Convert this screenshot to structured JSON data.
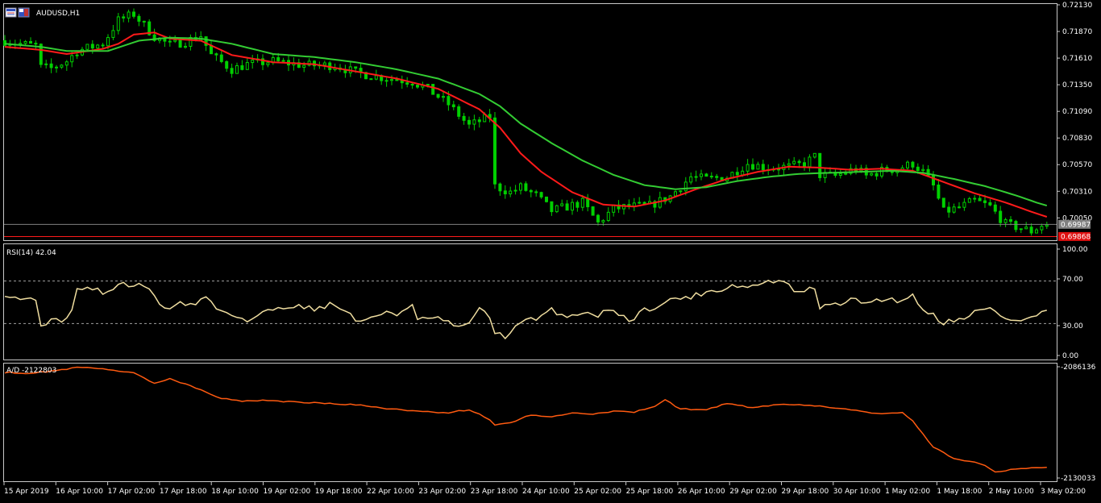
{
  "window": {
    "title": "AUDUSD,H1"
  },
  "colors": {
    "background": "#000000",
    "frame": "#c8c8c8",
    "text": "#ffffff",
    "candle": "#00d000",
    "ma_fast": "#ff1a1a",
    "ma_slow": "#33cc33",
    "bid_line": "#808080",
    "ask_line": "#ff1a1a",
    "bid_tag": "#808080",
    "ask_tag": "#e01010",
    "rsi": "#f0dea0",
    "rsi_levels": "#a0a0a0",
    "ad": "#ff5a10"
  },
  "icons": [
    "chart-window-icon"
  ],
  "main_pane": {
    "symbol_label": "AUDUSD,H1",
    "price_axis": [
      "0.72130",
      "0.71870",
      "0.71610",
      "0.71350",
      "0.71090",
      "0.70830",
      "0.70570",
      "0.70310",
      "0.70050"
    ],
    "bid_tag": "0.69987",
    "ask_tag": "0.69868"
  },
  "rsi_pane": {
    "label": "RSI(14) 42.04",
    "axis": [
      "100.00",
      "70.00",
      "30.00",
      "0.00"
    ]
  },
  "ad_pane": {
    "label": "A/D -2122803",
    "axis_top": "-2086136",
    "axis_bottom": "-2130033"
  },
  "time_axis": [
    "15 Apr 2019",
    "16 Apr 10:00",
    "17 Apr 02:00",
    "17 Apr 18:00",
    "18 Apr 10:00",
    "19 Apr 02:00",
    "19 Apr 18:00",
    "22 Apr 10:00",
    "23 Apr 02:00",
    "23 Apr 18:00",
    "24 Apr 10:00",
    "25 Apr 02:00",
    "25 Apr 18:00",
    "26 Apr 10:00",
    "29 Apr 02:00",
    "29 Apr 18:00",
    "30 Apr 10:00",
    "1 May 02:00",
    "1 May 18:00",
    "2 May 10:00",
    "3 May 02:00"
  ],
  "chart_data": [
    {
      "type": "candlestick",
      "title": "AUDUSD,H1",
      "ylim": [
        0.6984,
        0.7213
      ],
      "x_tick_labels": [
        "15 Apr 2019",
        "16 Apr 10:00",
        "17 Apr 02:00",
        "17 Apr 18:00",
        "18 Apr 10:00",
        "19 Apr 02:00",
        "19 Apr 18:00",
        "22 Apr 10:00",
        "23 Apr 02:00",
        "23 Apr 18:00",
        "24 Apr 10:00",
        "25 Apr 02:00",
        "25 Apr 18:00",
        "26 Apr 10:00",
        "29 Apr 02:00",
        "29 Apr 18:00",
        "30 Apr 10:00",
        "1 May 02:00",
        "1 May 18:00",
        "2 May 10:00",
        "3 May 02:00"
      ],
      "close_path": [
        [
          0,
          0.7178
        ],
        [
          3,
          0.7175
        ],
        [
          6,
          0.7173
        ],
        [
          7,
          0.7152
        ],
        [
          9,
          0.7151
        ],
        [
          12,
          0.7158
        ],
        [
          14,
          0.7168
        ],
        [
          19,
          0.7175
        ],
        [
          22,
          0.7198
        ],
        [
          25,
          0.7204
        ],
        [
          29,
          0.7182
        ],
        [
          32,
          0.7174
        ],
        [
          35,
          0.7177
        ],
        [
          38,
          0.7183
        ],
        [
          40,
          0.7164
        ],
        [
          44,
          0.715
        ],
        [
          47,
          0.7155
        ],
        [
          52,
          0.7158
        ],
        [
          58,
          0.7154
        ],
        [
          64,
          0.7154
        ],
        [
          68,
          0.7147
        ],
        [
          72,
          0.7143
        ],
        [
          76,
          0.714
        ],
        [
          79,
          0.7138
        ],
        [
          82,
          0.7131
        ],
        [
          86,
          0.7116
        ],
        [
          90,
          0.7095
        ],
        [
          94,
          0.7104
        ],
        [
          95,
          0.7036
        ],
        [
          98,
          0.703
        ],
        [
          100,
          0.7035
        ],
        [
          103,
          0.7027
        ],
        [
          106,
          0.7012
        ],
        [
          109,
          0.7016
        ],
        [
          112,
          0.702
        ],
        [
          115,
          0.7
        ],
        [
          118,
          0.7014
        ],
        [
          121,
          0.7016
        ],
        [
          125,
          0.7017
        ],
        [
          129,
          0.7026
        ],
        [
          133,
          0.7045
        ],
        [
          136,
          0.7043
        ],
        [
          140,
          0.7045
        ],
        [
          144,
          0.7058
        ],
        [
          148,
          0.7054
        ],
        [
          152,
          0.7055
        ],
        [
          155,
          0.7058
        ],
        [
          157,
          0.7065
        ],
        [
          158,
          0.7047
        ],
        [
          161,
          0.7046
        ],
        [
          165,
          0.7053
        ],
        [
          167,
          0.7046
        ],
        [
          170,
          0.7051
        ],
        [
          173,
          0.7053
        ],
        [
          176,
          0.7058
        ],
        [
          178,
          0.705
        ],
        [
          180,
          0.7036
        ],
        [
          182,
          0.7011
        ],
        [
          185,
          0.7015
        ],
        [
          188,
          0.7022
        ],
        [
          191,
          0.7016
        ],
        [
          194,
          0.6999
        ],
        [
          197,
          0.6995
        ],
        [
          199,
          0.6992
        ],
        [
          201,
          0.6998
        ]
      ],
      "series": [
        {
          "name": "MA fast",
          "points": [
            [
              0,
              0.7172
            ],
            [
              7,
              0.7169
            ],
            [
              12,
              0.7165
            ],
            [
              19,
              0.717
            ],
            [
              22,
              0.7175
            ],
            [
              25,
              0.7184
            ],
            [
              29,
              0.7186
            ],
            [
              32,
              0.718
            ],
            [
              38,
              0.7178
            ],
            [
              44,
              0.7164
            ],
            [
              52,
              0.7157
            ],
            [
              60,
              0.7155
            ],
            [
              68,
              0.7148
            ],
            [
              76,
              0.7141
            ],
            [
              84,
              0.7131
            ],
            [
              92,
              0.7111
            ],
            [
              96,
              0.7093
            ],
            [
              100,
              0.7068
            ],
            [
              104,
              0.705
            ],
            [
              110,
              0.703
            ],
            [
              116,
              0.7018
            ],
            [
              122,
              0.7016
            ],
            [
              128,
              0.7022
            ],
            [
              134,
              0.7033
            ],
            [
              140,
              0.7043
            ],
            [
              146,
              0.705
            ],
            [
              152,
              0.7055
            ],
            [
              158,
              0.7054
            ],
            [
              164,
              0.7052
            ],
            [
              170,
              0.7053
            ],
            [
              176,
              0.7051
            ],
            [
              182,
              0.704
            ],
            [
              188,
              0.7029
            ],
            [
              194,
              0.702
            ],
            [
              199,
              0.7011
            ],
            [
              202,
              0.7006
            ]
          ]
        },
        {
          "name": "MA slow",
          "points": [
            [
              0,
              0.7175
            ],
            [
              7,
              0.7172
            ],
            [
              12,
              0.7168
            ],
            [
              20,
              0.7168
            ],
            [
              26,
              0.7178
            ],
            [
              32,
              0.7181
            ],
            [
              38,
              0.718
            ],
            [
              44,
              0.7175
            ],
            [
              52,
              0.7165
            ],
            [
              60,
              0.7162
            ],
            [
              68,
              0.7157
            ],
            [
              76,
              0.715
            ],
            [
              84,
              0.7141
            ],
            [
              92,
              0.7126
            ],
            [
              96,
              0.7114
            ],
            [
              100,
              0.7097
            ],
            [
              106,
              0.7078
            ],
            [
              112,
              0.7061
            ],
            [
              118,
              0.7047
            ],
            [
              124,
              0.7037
            ],
            [
              130,
              0.7033
            ],
            [
              136,
              0.7035
            ],
            [
              142,
              0.7041
            ],
            [
              148,
              0.7045
            ],
            [
              154,
              0.7048
            ],
            [
              160,
              0.7049
            ],
            [
              166,
              0.705
            ],
            [
              172,
              0.7051
            ],
            [
              178,
              0.7049
            ],
            [
              184,
              0.7043
            ],
            [
              190,
              0.7036
            ],
            [
              196,
              0.7027
            ],
            [
              200,
              0.702
            ],
            [
              202,
              0.7017
            ]
          ]
        }
      ],
      "bid": 0.69987,
      "ask": 0.69868,
      "grid": false
    },
    {
      "type": "line",
      "title": "RSI(14) 42.04",
      "ylim": [
        0,
        100
      ],
      "levels": [
        70,
        30
      ],
      "series": [
        {
          "name": "RSI(14)",
          "points": [
            [
              0,
              58
            ],
            [
              3,
              54
            ],
            [
              6,
              52
            ],
            [
              7,
              30
            ],
            [
              9,
              32
            ],
            [
              12,
              34
            ],
            [
              13,
              45
            ],
            [
              14,
              62
            ],
            [
              17,
              63
            ],
            [
              20,
              58
            ],
            [
              22,
              68
            ],
            [
              24,
              66
            ],
            [
              27,
              66
            ],
            [
              29,
              55
            ],
            [
              31,
              44
            ],
            [
              34,
              49
            ],
            [
              37,
              48
            ],
            [
              39,
              56
            ],
            [
              41,
              44
            ],
            [
              43,
              41
            ],
            [
              45,
              37
            ],
            [
              47,
              32
            ],
            [
              50,
              40
            ],
            [
              53,
              45
            ],
            [
              56,
              47
            ],
            [
              60,
              44
            ],
            [
              63,
              48
            ],
            [
              66,
              43
            ],
            [
              68,
              33
            ],
            [
              71,
              34
            ],
            [
              74,
              42
            ],
            [
              76,
              39
            ],
            [
              79,
              46
            ],
            [
              80,
              33
            ],
            [
              83,
              36
            ],
            [
              86,
              31
            ],
            [
              88,
              25
            ],
            [
              90,
              32
            ],
            [
              92,
              43
            ],
            [
              94,
              36
            ],
            [
              95,
              22
            ],
            [
              97,
              18
            ],
            [
              99,
              26
            ],
            [
              101,
              34
            ],
            [
              103,
              33
            ],
            [
              106,
              43
            ],
            [
              109,
              36
            ],
            [
              112,
              41
            ],
            [
              115,
              38
            ],
            [
              118,
              44
            ],
            [
              121,
              32
            ],
            [
              124,
              43
            ],
            [
              127,
              47
            ],
            [
              130,
              54
            ],
            [
              133,
              55
            ],
            [
              136,
              60
            ],
            [
              139,
              62
            ],
            [
              141,
              66
            ],
            [
              144,
              64
            ],
            [
              147,
              68
            ],
            [
              150,
              71
            ],
            [
              152,
              65
            ],
            [
              154,
              58
            ],
            [
              157,
              64
            ],
            [
              158,
              45
            ],
            [
              161,
              48
            ],
            [
              164,
              52
            ],
            [
              167,
              50
            ],
            [
              170,
              53
            ],
            [
              173,
              52
            ],
            [
              176,
              56
            ],
            [
              178,
              44
            ],
            [
              180,
              38
            ],
            [
              182,
              31
            ],
            [
              185,
              34
            ],
            [
              188,
              41
            ],
            [
              191,
              44
            ],
            [
              194,
              35
            ],
            [
              197,
              32
            ],
            [
              199,
              36
            ],
            [
              202,
              42
            ]
          ]
        }
      ]
    },
    {
      "type": "line",
      "title": "A/D -2122803",
      "ylim": [
        -2130033,
        -2086136
      ],
      "series": [
        {
          "name": "A/D",
          "points": [
            [
              0,
              -2088300
            ],
            [
              5,
              -2088800
            ],
            [
              10,
              -2087500
            ],
            [
              15,
              -2086200
            ],
            [
              20,
              -2087100
            ],
            [
              25,
              -2088700
            ],
            [
              29,
              -2092500
            ],
            [
              32,
              -2091000
            ],
            [
              35,
              -2092800
            ],
            [
              38,
              -2095200
            ],
            [
              42,
              -2098600
            ],
            [
              46,
              -2099800
            ],
            [
              50,
              -2099300
            ],
            [
              56,
              -2100000
            ],
            [
              62,
              -2100600
            ],
            [
              68,
              -2101100
            ],
            [
              74,
              -2102600
            ],
            [
              80,
              -2103800
            ],
            [
              86,
              -2104200
            ],
            [
              90,
              -2103100
            ],
            [
              92,
              -2104800
            ],
            [
              94,
              -2107000
            ],
            [
              95,
              -2109300
            ],
            [
              98,
              -2108100
            ],
            [
              102,
              -2105100
            ],
            [
              106,
              -2105900
            ],
            [
              110,
              -2104400
            ],
            [
              114,
              -2104700
            ],
            [
              118,
              -2103800
            ],
            [
              122,
              -2104000
            ],
            [
              126,
              -2101900
            ],
            [
              128,
              -2099200
            ],
            [
              131,
              -2102800
            ],
            [
              136,
              -2103100
            ],
            [
              140,
              -2100600
            ],
            [
              145,
              -2102300
            ],
            [
              150,
              -2101100
            ],
            [
              155,
              -2101300
            ],
            [
              160,
              -2102100
            ],
            [
              166,
              -2103700
            ],
            [
              170,
              -2104900
            ],
            [
              174,
              -2104300
            ],
            [
              176,
              -2107400
            ],
            [
              180,
              -2117900
            ],
            [
              184,
              -2122400
            ],
            [
              188,
              -2123600
            ],
            [
              190,
              -2125300
            ],
            [
              192,
              -2127800
            ],
            [
              195,
              -2126600
            ],
            [
              198,
              -2126200
            ],
            [
              202,
              -2125700
            ]
          ]
        }
      ]
    }
  ]
}
